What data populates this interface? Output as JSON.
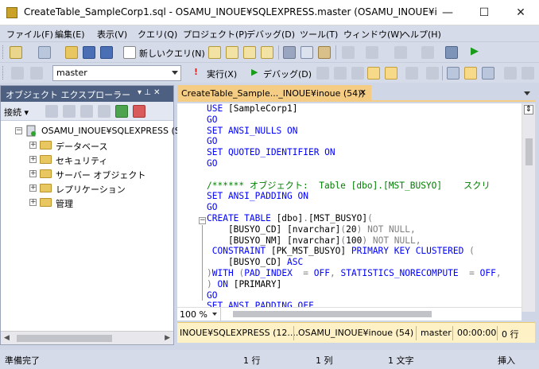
{
  "window": {
    "title": "CreateTable_SampleCorp1.sql - OSAMU_INOUE¥SQLEXPRESS.master (OSAMU_INOUE¥inoue (54...",
    "minimize": "—",
    "maximize": "☐",
    "close": "✕"
  },
  "menu": [
    "ファイル(F)",
    "編集(E)",
    "表示(V)",
    "クエリ(Q)",
    "プロジェクト(P)",
    "デバッグ(D)",
    "ツール(T)",
    "ウィンドウ(W)",
    "ヘルプ(H)"
  ],
  "toolbar1": {
    "new_query": "新しいクエリ(N)"
  },
  "toolbar2": {
    "database": "master",
    "execute": "実行(X)",
    "debug": "デバッグ(D)"
  },
  "explorer": {
    "title": "オブジェクト エクスプローラー",
    "pin": "▾ ⊥ ✕",
    "connect": "接続 ▾",
    "server": "OSAMU_INOUE¥SQLEXPRESS (S",
    "folders": [
      "データベース",
      "セキュリティ",
      "サーバー オブジェクト",
      "レプリケーション",
      "管理"
    ]
  },
  "editor": {
    "tab": "CreateTable_Sample..._INOUE¥inoue (54))",
    "tab_close": "✕",
    "zoom": "100 %",
    "split_icon": "⇕"
  },
  "connection": {
    "server": "INOUE¥SQLEXPRESS (12....",
    "user": "OSAMU_INOUE¥inoue (54)",
    "database": "master",
    "time": "00:00:00",
    "rows": "0 行"
  },
  "status": {
    "ready": "準備完了",
    "line": "1 行",
    "col": "1 列",
    "char": "1 文字",
    "mode": "挿入"
  },
  "colors": {
    "keyword": "#0000ff",
    "comment": "#008000",
    "gray": "#808080",
    "tab": "#f5cc84"
  },
  "code_lines": [
    [
      [
        "kw",
        "USE "
      ],
      [
        "",
        "[SampleCorp1]"
      ]
    ],
    [
      [
        "kw",
        "GO"
      ]
    ],
    [
      [
        "kw",
        "SET ANSI_NULLS ON"
      ]
    ],
    [
      [
        "kw",
        "GO"
      ]
    ],
    [
      [
        "kw",
        "SET QUOTED_IDENTIFIER ON"
      ]
    ],
    [
      [
        "kw",
        "GO"
      ]
    ],
    [
      [
        "",
        ""
      ]
    ],
    [
      [
        "cm",
        "/****** オブジェクト:  Table [dbo].[MST_BUSYO]    スクリ"
      ]
    ],
    [
      [
        "kw",
        "SET ANSI_PADDING ON"
      ]
    ],
    [
      [
        "kw",
        "GO"
      ]
    ],
    [
      [
        "kw",
        "CREATE TABLE "
      ],
      [
        "",
        "[dbo]"
      ],
      [
        "gr",
        "."
      ],
      [
        "",
        "[MST_BUSYO]"
      ],
      [
        "gr",
        "("
      ]
    ],
    [
      [
        "",
        "    [BUSYO_CD] "
      ],
      [
        "",
        "[nvarchar]"
      ],
      [
        "gr",
        "("
      ],
      [
        "",
        "20"
      ],
      [
        "gr",
        ") NOT NULL,"
      ]
    ],
    [
      [
        "",
        "    [BUSYO_NM] "
      ],
      [
        "",
        "[nvarchar]"
      ],
      [
        "gr",
        "("
      ],
      [
        "",
        "100"
      ],
      [
        "gr",
        ") NOT NULL,"
      ]
    ],
    [
      [
        "kw",
        " CONSTRAINT "
      ],
      [
        "",
        "[PK_MST_BUSYO] "
      ],
      [
        "kw",
        "PRIMARY KEY CLUSTERED "
      ],
      [
        "gr",
        "("
      ]
    ],
    [
      [
        "",
        "    [BUSYO_CD] "
      ],
      [
        "kw",
        "ASC"
      ]
    ],
    [
      [
        "gr",
        ")"
      ],
      [
        "kw",
        "WITH "
      ],
      [
        "gr",
        "("
      ],
      [
        "kw",
        "PAD_INDEX  "
      ],
      [
        "gr",
        "= "
      ],
      [
        "kw",
        "OFF"
      ],
      [
        "gr",
        ", "
      ],
      [
        "kw",
        "STATISTICS_NORECOMPUTE  "
      ],
      [
        "gr",
        "= "
      ],
      [
        "kw",
        "OFF"
      ],
      [
        "gr",
        ","
      ]
    ],
    [
      [
        "gr",
        ") "
      ],
      [
        "kw",
        "ON "
      ],
      [
        "",
        "[PRIMARY]"
      ]
    ],
    [
      [
        "kw",
        "GO"
      ]
    ],
    [
      [
        "kw",
        "SET ANSI_PADDING OFF"
      ]
    ]
  ]
}
